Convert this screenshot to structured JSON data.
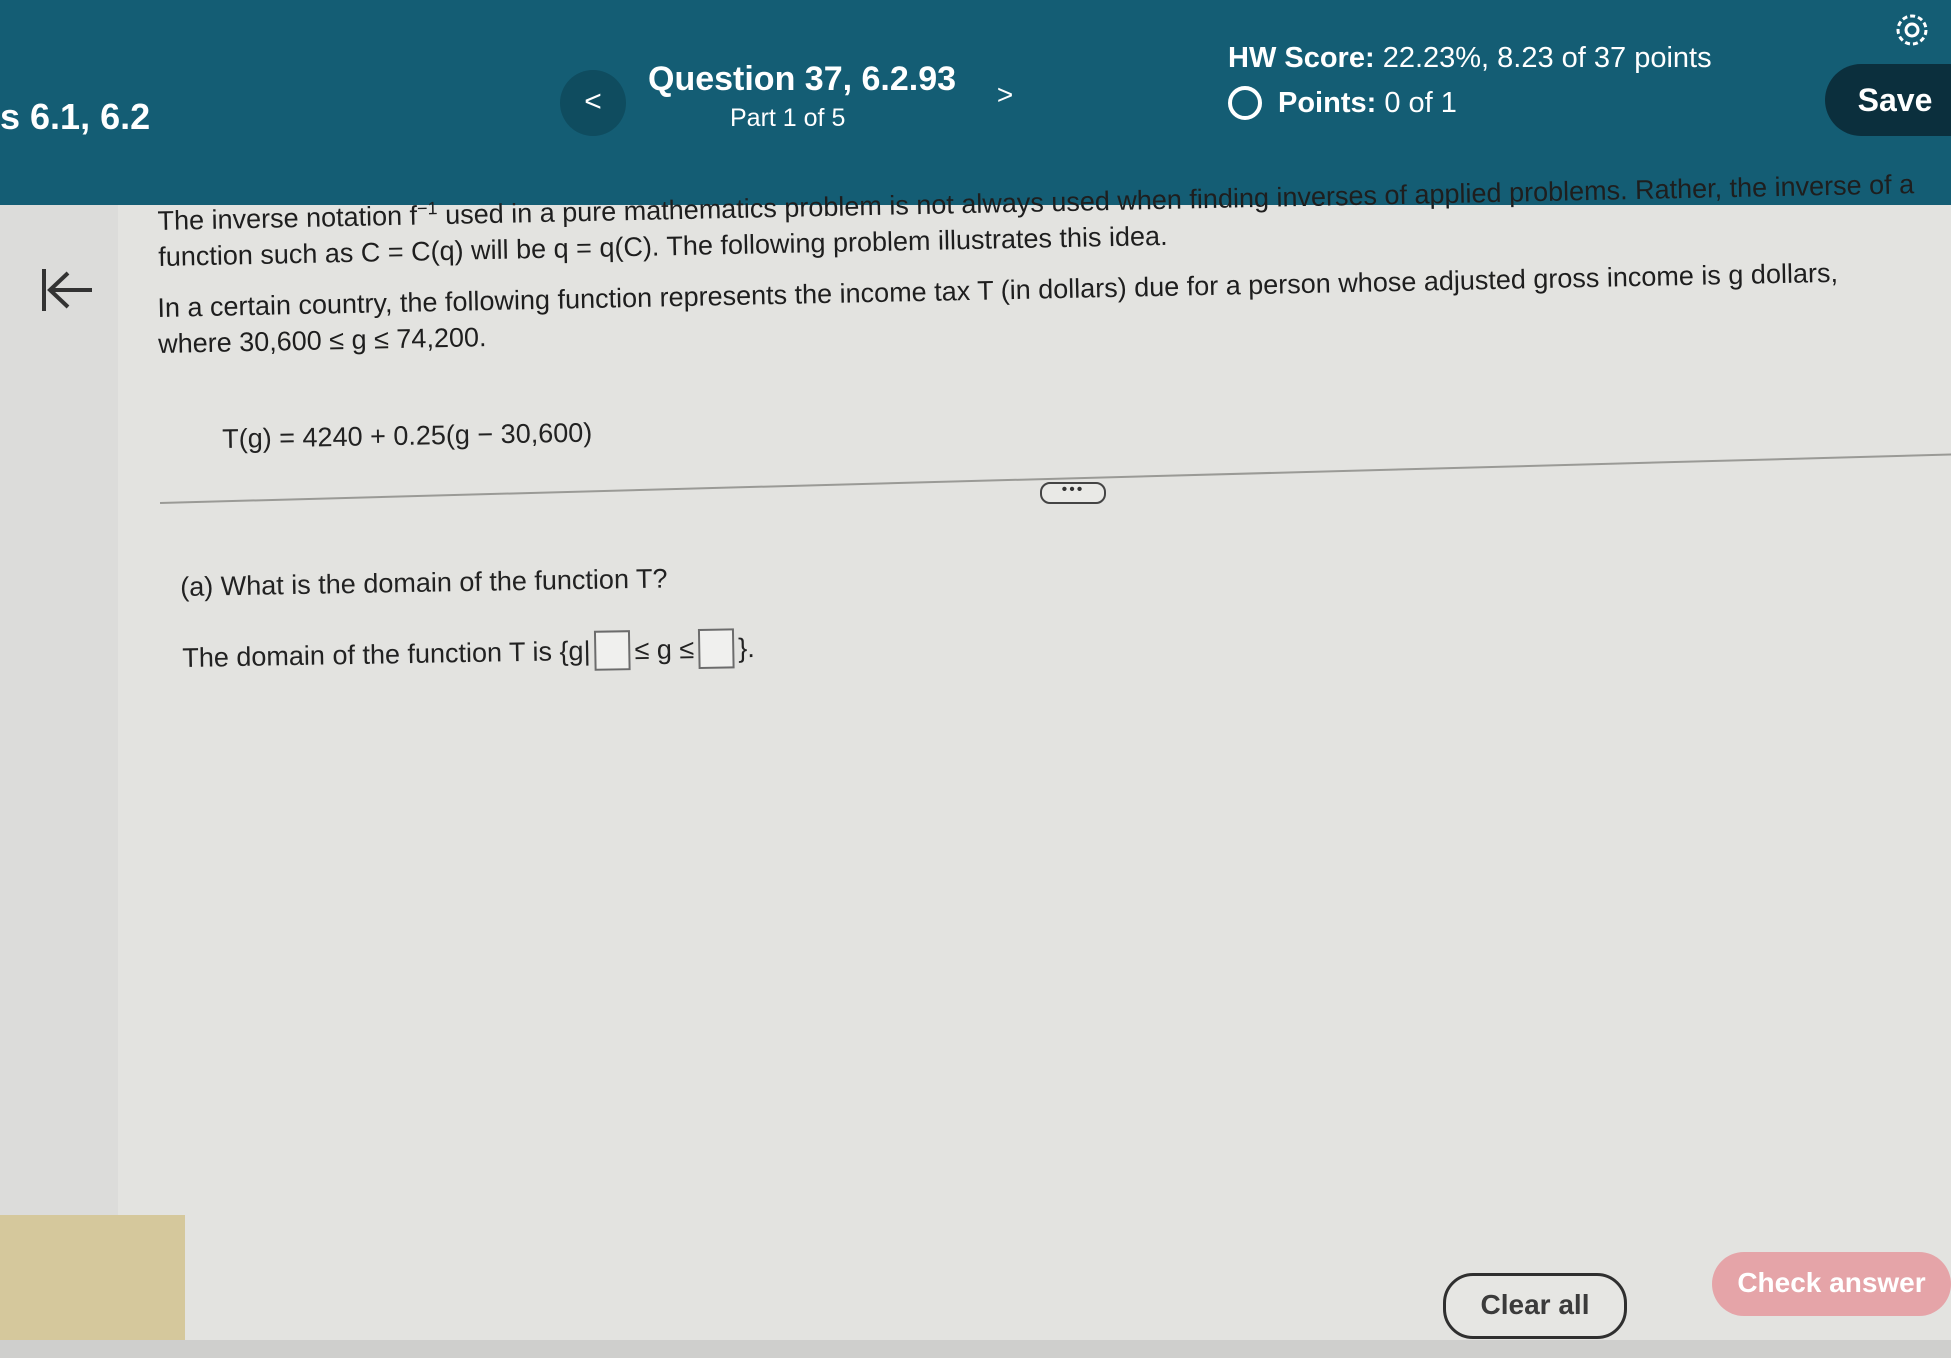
{
  "header": {
    "section": "s 6.1, 6.2",
    "question_title": "Question 37, 6.2.93",
    "part": "Part 1 of 5",
    "prev_label": "<",
    "next_label": ">",
    "hw_score_label": "HW Score:",
    "hw_score_value": "22.23%, 8.23 of 37 points",
    "points_label": "Points:",
    "points_value": "0 of 1",
    "save_label": "Save"
  },
  "problem": {
    "intro_1": "The inverse notation f",
    "intro_sup": "−1",
    "intro_2": " used in a pure mathematics problem is not always used when finding inverses of applied problems.  Rather, the inverse of a function such as C = C(q) will be q = q(C).  The following problem illustrates this idea.",
    "scenario": "In a certain country, the following function represents the income tax T (in dollars) due for a person whose adjusted gross income is g dollars, where 30,600 ≤ g ≤ 74,200.",
    "equation": "T(g) = 4240 + 0.25(g − 30,600)",
    "more_label": "•••"
  },
  "part_a": {
    "question": "(a)  What is the domain of the function T?",
    "answer_prefix": "The domain of the function T is {g|",
    "answer_middle": "≤ g ≤",
    "answer_suffix": "}.",
    "box1_value": "",
    "box2_value": ""
  },
  "footer": {
    "clear_label": "Clear all",
    "check_label": "Check answer"
  },
  "colors": {
    "header_bg": "#145d74",
    "save_bg": "#0b2f3d",
    "check_bg": "#e5a4a8"
  },
  "icons": [
    "gear-icon",
    "back-arrow-icon",
    "radio-icon"
  ]
}
